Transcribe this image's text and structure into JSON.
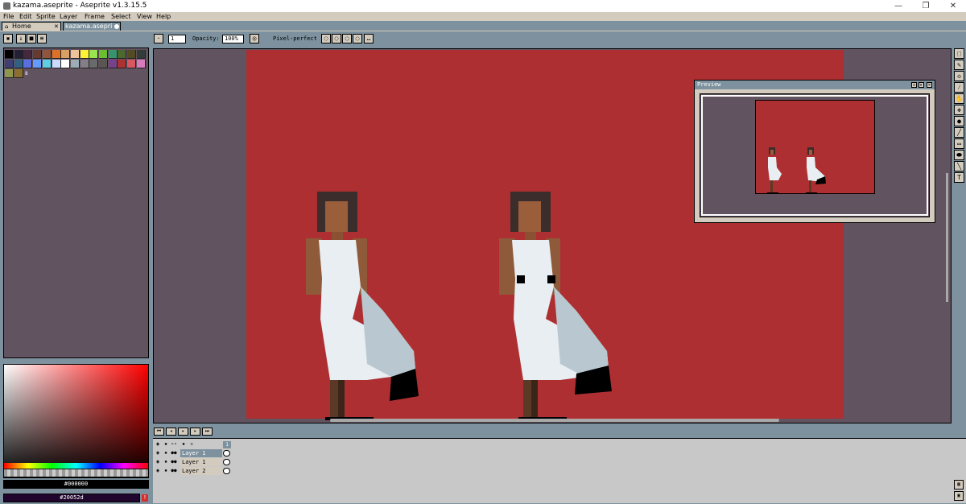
{
  "window": {
    "title": "kazama.aseprite - Aseprite v1.3.15.5",
    "minimize": "—",
    "maximize": "❐",
    "close": "✕"
  },
  "menu": [
    "File",
    "Edit",
    "Sprite",
    "Layer",
    "Frame",
    "Select",
    "View",
    "Help"
  ],
  "tabs": {
    "home": "Home",
    "home_close": "✕",
    "file": "kazama.asepri"
  },
  "toolbar": {
    "brush_size": "1",
    "opacity_label": "Opacity:",
    "opacity_value": "100%",
    "pixel_perfect_label": "Pixel-perfect"
  },
  "palette": {
    "colors": [
      "#000000",
      "#222034",
      "#45283c",
      "#663931",
      "#8f563b",
      "#df7126",
      "#d9a066",
      "#eec39a",
      "#fbf236",
      "#99e550",
      "#6abe30",
      "#37946e",
      "#4b692f",
      "#524b24",
      "#323c39",
      "#3f3f74",
      "#306082",
      "#5b6ee1",
      "#639bff",
      "#5fcde4",
      "#cbdbfc",
      "#ffffff",
      "#9badb7",
      "#847e87",
      "#696a6a",
      "#595652",
      "#76428a",
      "#ac3232",
      "#d95763",
      "#d77bba",
      "#8f974a",
      "#8a6f30"
    ],
    "index_mark": "8"
  },
  "colors": {
    "foreground": "#000000",
    "background": "#20052d",
    "foreground_hex": "#000000",
    "background_hex": "#20052d",
    "canvas_bg": "#625360",
    "sprite_bg": "#ae2f31"
  },
  "preview": {
    "title": "Preview"
  },
  "timeline": {
    "frame_number": "1",
    "layers": [
      {
        "name": "Layer 1",
        "selected": true
      },
      {
        "name": "Layer 1",
        "selected": false
      },
      {
        "name": "Layer 2",
        "selected": false
      }
    ]
  },
  "icons": {
    "tools": [
      "marquee-icon",
      "pencil-icon",
      "eraser-icon",
      "eyedropper-icon",
      "hand-icon",
      "move-icon",
      "fill-icon",
      "line-icon",
      "rectangle-icon",
      "ellipse-icon",
      "blur-icon",
      "text-icon"
    ]
  }
}
